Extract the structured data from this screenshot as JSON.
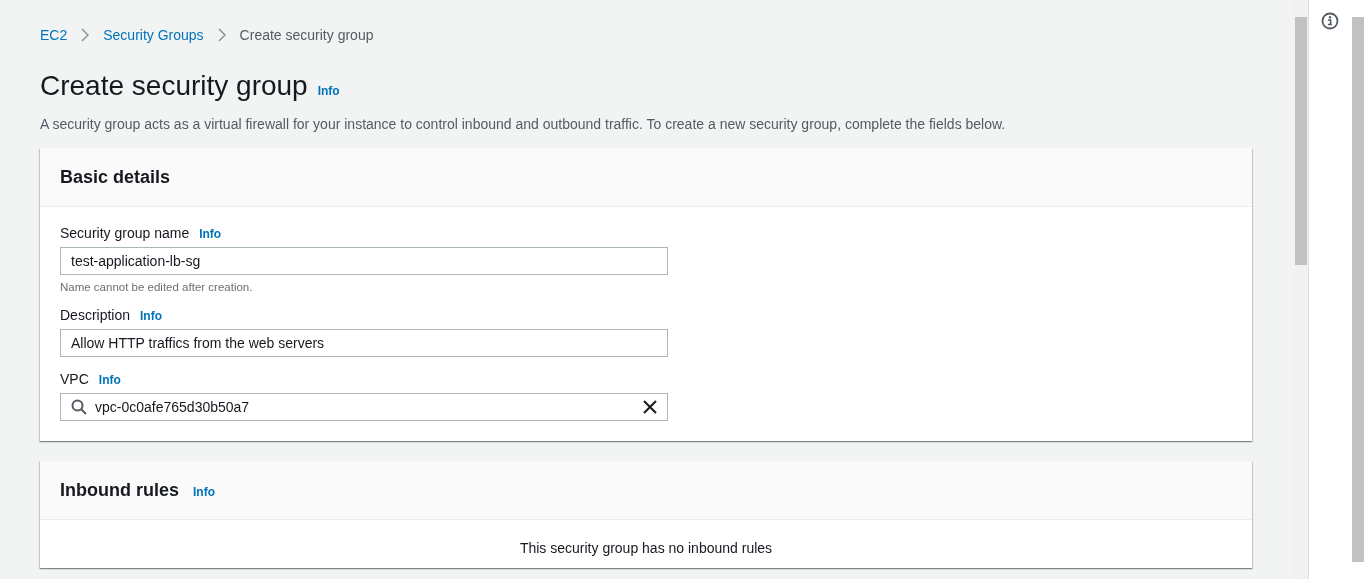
{
  "breadcrumbs": [
    {
      "label": "EC2",
      "kind": "link"
    },
    {
      "label": "Security Groups",
      "kind": "link"
    },
    {
      "label": "Create security group",
      "kind": "current"
    }
  ],
  "page": {
    "title": "Create security group",
    "info": "Info",
    "description": "A security group acts as a virtual firewall for your instance to control inbound and outbound traffic. To create a new security group, complete the fields below."
  },
  "basic_details": {
    "title": "Basic details",
    "fields": [
      {
        "label": "Security group name",
        "info": "Info",
        "value": "test-application-lb-sg",
        "hint": "Name cannot be edited after creation.",
        "kind": "text"
      },
      {
        "label": "Description",
        "info": "Info",
        "value": "Allow HTTP traffics from the web servers",
        "kind": "text"
      },
      {
        "label": "VPC",
        "info": "Info",
        "value": "vpc-0c0afe765d30b50a7",
        "kind": "search"
      }
    ]
  },
  "inbound_rules": {
    "title": "Inbound rules",
    "info": "Info",
    "empty_message": "This security group has no inbound rules"
  }
}
